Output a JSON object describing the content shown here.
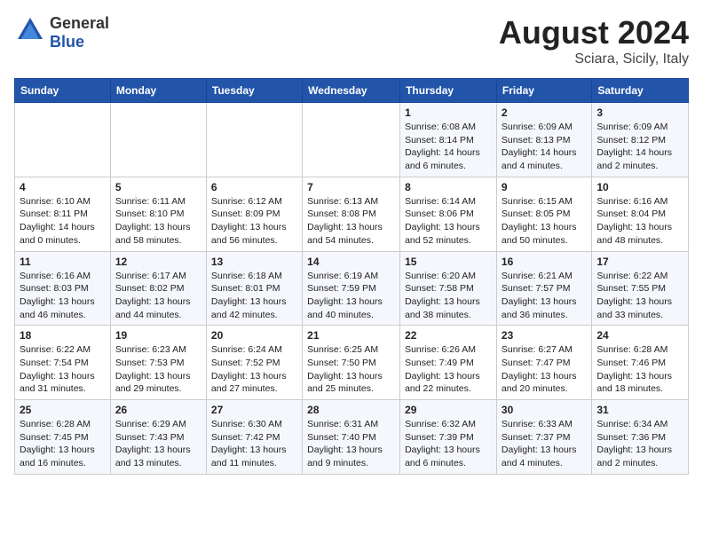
{
  "header": {
    "logo_line1": "General",
    "logo_line2": "Blue",
    "month_year": "August 2024",
    "location": "Sciara, Sicily, Italy"
  },
  "weekdays": [
    "Sunday",
    "Monday",
    "Tuesday",
    "Wednesday",
    "Thursday",
    "Friday",
    "Saturday"
  ],
  "weeks": [
    [
      {
        "day": "",
        "info": ""
      },
      {
        "day": "",
        "info": ""
      },
      {
        "day": "",
        "info": ""
      },
      {
        "day": "",
        "info": ""
      },
      {
        "day": "1",
        "info": "Sunrise: 6:08 AM\nSunset: 8:14 PM\nDaylight: 14 hours and 6 minutes."
      },
      {
        "day": "2",
        "info": "Sunrise: 6:09 AM\nSunset: 8:13 PM\nDaylight: 14 hours and 4 minutes."
      },
      {
        "day": "3",
        "info": "Sunrise: 6:09 AM\nSunset: 8:12 PM\nDaylight: 14 hours and 2 minutes."
      }
    ],
    [
      {
        "day": "4",
        "info": "Sunrise: 6:10 AM\nSunset: 8:11 PM\nDaylight: 14 hours and 0 minutes."
      },
      {
        "day": "5",
        "info": "Sunrise: 6:11 AM\nSunset: 8:10 PM\nDaylight: 13 hours and 58 minutes."
      },
      {
        "day": "6",
        "info": "Sunrise: 6:12 AM\nSunset: 8:09 PM\nDaylight: 13 hours and 56 minutes."
      },
      {
        "day": "7",
        "info": "Sunrise: 6:13 AM\nSunset: 8:08 PM\nDaylight: 13 hours and 54 minutes."
      },
      {
        "day": "8",
        "info": "Sunrise: 6:14 AM\nSunset: 8:06 PM\nDaylight: 13 hours and 52 minutes."
      },
      {
        "day": "9",
        "info": "Sunrise: 6:15 AM\nSunset: 8:05 PM\nDaylight: 13 hours and 50 minutes."
      },
      {
        "day": "10",
        "info": "Sunrise: 6:16 AM\nSunset: 8:04 PM\nDaylight: 13 hours and 48 minutes."
      }
    ],
    [
      {
        "day": "11",
        "info": "Sunrise: 6:16 AM\nSunset: 8:03 PM\nDaylight: 13 hours and 46 minutes."
      },
      {
        "day": "12",
        "info": "Sunrise: 6:17 AM\nSunset: 8:02 PM\nDaylight: 13 hours and 44 minutes."
      },
      {
        "day": "13",
        "info": "Sunrise: 6:18 AM\nSunset: 8:01 PM\nDaylight: 13 hours and 42 minutes."
      },
      {
        "day": "14",
        "info": "Sunrise: 6:19 AM\nSunset: 7:59 PM\nDaylight: 13 hours and 40 minutes."
      },
      {
        "day": "15",
        "info": "Sunrise: 6:20 AM\nSunset: 7:58 PM\nDaylight: 13 hours and 38 minutes."
      },
      {
        "day": "16",
        "info": "Sunrise: 6:21 AM\nSunset: 7:57 PM\nDaylight: 13 hours and 36 minutes."
      },
      {
        "day": "17",
        "info": "Sunrise: 6:22 AM\nSunset: 7:55 PM\nDaylight: 13 hours and 33 minutes."
      }
    ],
    [
      {
        "day": "18",
        "info": "Sunrise: 6:22 AM\nSunset: 7:54 PM\nDaylight: 13 hours and 31 minutes."
      },
      {
        "day": "19",
        "info": "Sunrise: 6:23 AM\nSunset: 7:53 PM\nDaylight: 13 hours and 29 minutes."
      },
      {
        "day": "20",
        "info": "Sunrise: 6:24 AM\nSunset: 7:52 PM\nDaylight: 13 hours and 27 minutes."
      },
      {
        "day": "21",
        "info": "Sunrise: 6:25 AM\nSunset: 7:50 PM\nDaylight: 13 hours and 25 minutes."
      },
      {
        "day": "22",
        "info": "Sunrise: 6:26 AM\nSunset: 7:49 PM\nDaylight: 13 hours and 22 minutes."
      },
      {
        "day": "23",
        "info": "Sunrise: 6:27 AM\nSunset: 7:47 PM\nDaylight: 13 hours and 20 minutes."
      },
      {
        "day": "24",
        "info": "Sunrise: 6:28 AM\nSunset: 7:46 PM\nDaylight: 13 hours and 18 minutes."
      }
    ],
    [
      {
        "day": "25",
        "info": "Sunrise: 6:28 AM\nSunset: 7:45 PM\nDaylight: 13 hours and 16 minutes."
      },
      {
        "day": "26",
        "info": "Sunrise: 6:29 AM\nSunset: 7:43 PM\nDaylight: 13 hours and 13 minutes."
      },
      {
        "day": "27",
        "info": "Sunrise: 6:30 AM\nSunset: 7:42 PM\nDaylight: 13 hours and 11 minutes."
      },
      {
        "day": "28",
        "info": "Sunrise: 6:31 AM\nSunset: 7:40 PM\nDaylight: 13 hours and 9 minutes."
      },
      {
        "day": "29",
        "info": "Sunrise: 6:32 AM\nSunset: 7:39 PM\nDaylight: 13 hours and 6 minutes."
      },
      {
        "day": "30",
        "info": "Sunrise: 6:33 AM\nSunset: 7:37 PM\nDaylight: 13 hours and 4 minutes."
      },
      {
        "day": "31",
        "info": "Sunrise: 6:34 AM\nSunset: 7:36 PM\nDaylight: 13 hours and 2 minutes."
      }
    ]
  ]
}
